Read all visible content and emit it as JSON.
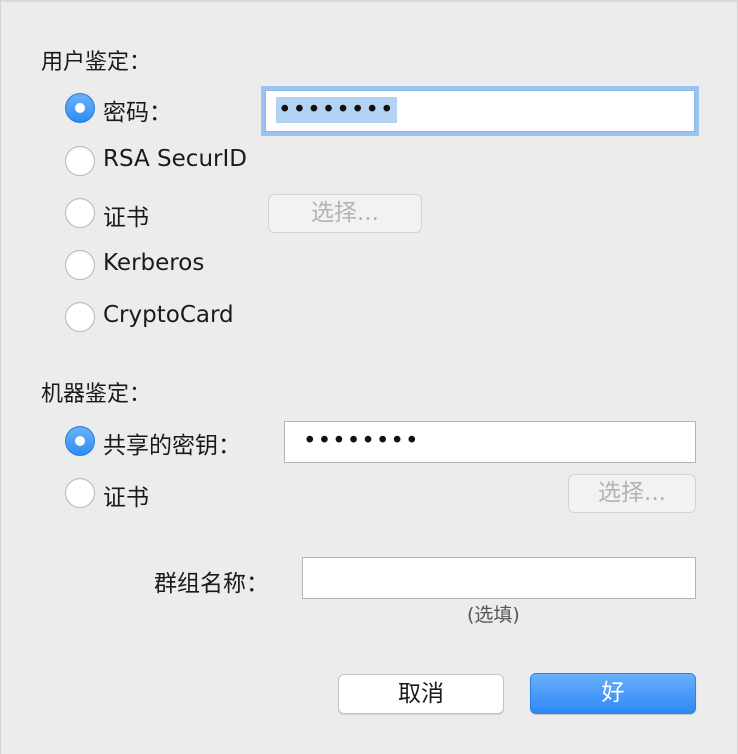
{
  "user_auth": {
    "title": "用户鉴定：",
    "options": [
      {
        "label": "密码：",
        "selected": true
      },
      {
        "label": "RSA SecurID",
        "selected": false
      },
      {
        "label": "证书",
        "selected": false
      },
      {
        "label": "Kerberos",
        "selected": false
      },
      {
        "label": "CryptoCard",
        "selected": false
      }
    ],
    "password_value": "••••••••",
    "cert_button": "选择..."
  },
  "machine_auth": {
    "title": "机器鉴定：",
    "options": [
      {
        "label": "共享的密钥：",
        "selected": true
      },
      {
        "label": "证书",
        "selected": false
      }
    ],
    "shared_secret_value": "••••••••",
    "cert_button": "选择..."
  },
  "group": {
    "label": "群组名称：",
    "value": "",
    "hint": "(选填)"
  },
  "actions": {
    "cancel": "取消",
    "ok": "好"
  },
  "colors": {
    "accent": "#2f89f4",
    "background": "#ececec",
    "focus_ring": "#9cc2ef"
  }
}
